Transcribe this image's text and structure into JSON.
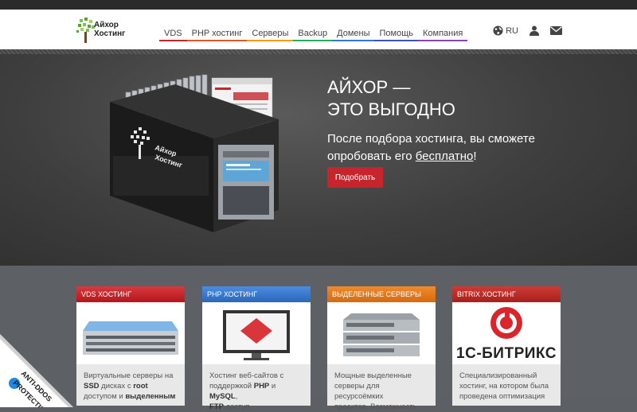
{
  "brand": {
    "logo_text_line1": "Айхор",
    "logo_text_line2": "Хостинг"
  },
  "nav": {
    "items": [
      {
        "label": "VDS",
        "color": "#c6262b"
      },
      {
        "label": "PHP хостинг",
        "color": "#e05a22"
      },
      {
        "label": "Серверы",
        "color": "#f39c12"
      },
      {
        "label": "Backup",
        "color": "#27ae60"
      },
      {
        "label": "Домены",
        "color": "#2b7bd6"
      },
      {
        "label": "Помощь",
        "color": "#3f51b5"
      },
      {
        "label": "Компания",
        "color": "#8e44ad"
      }
    ]
  },
  "header": {
    "lang": "RU",
    "globe_icon": "globe-icon",
    "user_icon": "user-icon",
    "mail_icon": "mail-icon"
  },
  "hero": {
    "title_line1": "АЙХОР —",
    "title_line2": "ЭТО ВЫГОДНО",
    "sub_part1": "После подбора хостинга, вы сможете",
    "sub_part2": "опробовать его ",
    "sub_link": "бесплатно",
    "sub_end": "!",
    "button": "Подобрать",
    "server_text_line1": "Айхор",
    "server_text_line2": "Хостинг"
  },
  "cards": [
    {
      "title": "VDS ХОСТИНГ",
      "color": "#c6262b",
      "t1": "Виртуальные серверы на",
      "t2b": "SSD",
      "t2": " дисках с ",
      "t2c": "root",
      "t3": "доступом и ",
      "t3b": "выделенным"
    },
    {
      "title": "PHP ХОСТИНГ",
      "color": "#3a7bd5",
      "t1": "Хостинг веб-сайтов с",
      "t2": "поддержкой ",
      "t2b": "PHP",
      "t2m": " и ",
      "t2c": "MySQL",
      "t2e": ",",
      "t3b": "FTP",
      "t3": " доступ"
    },
    {
      "title": "ВЫДЕЛЕННЫЕ СЕРВЕРЫ",
      "color": "#e67e22",
      "t1": "Мощные выделенные",
      "t2": "серверы для ресурсоёмких",
      "t3": "проектов. Возможность"
    },
    {
      "title": "BITRIX ХОСТИНГ",
      "color": "#c0392b",
      "logo_text": "1С-БИТРИКС",
      "t1": "Специализированный",
      "t2": "хостинг, на котором была",
      "t3": "проведена оптимизация"
    }
  ],
  "badge": {
    "line1": "ANTI-DDOS",
    "line2": "PROTECTION"
  }
}
